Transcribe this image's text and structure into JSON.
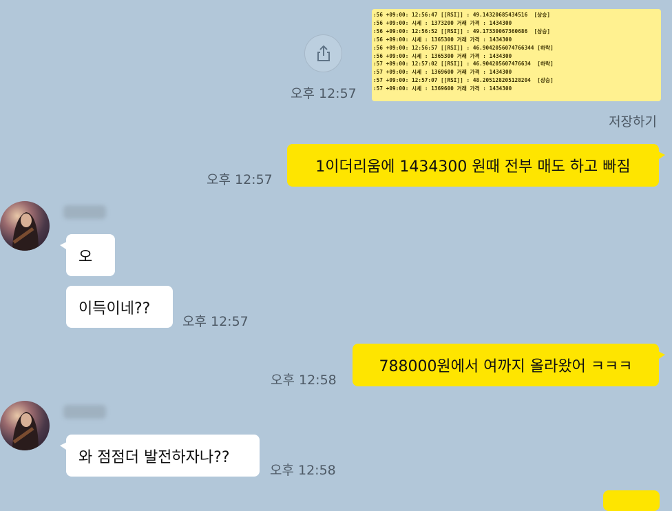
{
  "chat": {
    "image_message": {
      "log_lines": [
        ":56 +09:00: 12:56:47 [[RSI]] : 49.14320685434516  [상승]",
        ":56 +09:00: 시세 : 1373200 거래 가격 : 1434300",
        ":56 +09:00: 12:56:52 [[RSI]] : 49.17330067360686  [상승]",
        ":56 +09:00: 시세 : 1365300 거래 가격 : 1434300",
        ":56 +09:00: 12:56:57 [[RSI]] : 46.9042056074766344 [하락]",
        ":56 +09:00: 시세 : 1365300 거래 가격 : 1434300",
        ":57 +09:00: 12:57:02 [[RSI]] : 46.904205607476634  [하락]",
        ":57 +09:00: 시세 : 1369600 거래 가격 : 1434300",
        ":57 +09:00: 12:57:07 [[RSI]] : 48.205128205128204  [상승]",
        ":57 +09:00: 시세 : 1369600 거래 가격 : 1434300"
      ],
      "time": "오후 12:57",
      "save_label": "저장하기"
    },
    "messages": [
      {
        "text": "1이더리움에 1434300 원때 전부 매도 하고 빠짐",
        "time": "오후 12:57"
      },
      {
        "text": "오"
      },
      {
        "text": "이득이네??",
        "time": "오후 12:57"
      },
      {
        "text": "788000원에서 여까지 올라왔어 ㅋㅋㅋ",
        "time": "오후 12:58"
      },
      {
        "text": "와 점점더 발전하자나??",
        "time": "오후 12:58"
      }
    ]
  },
  "icons": {
    "share": "share-icon",
    "avatar": "profile-avatar"
  },
  "colors": {
    "background": "#b2c7d9",
    "my_bubble": "#fee500",
    "other_bubble": "#ffffff"
  }
}
